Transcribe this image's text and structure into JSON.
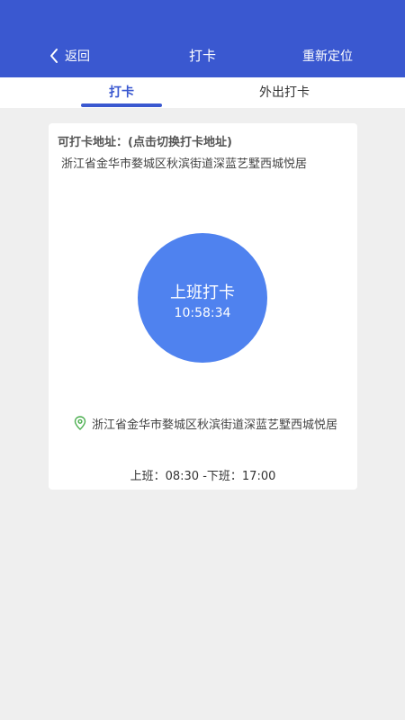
{
  "header": {
    "back_label": "返回",
    "title": "打卡",
    "relocate_label": "重新定位",
    "back_icon": "chevron-left-icon",
    "background": "#3a58d0"
  },
  "tabs": [
    {
      "label": "打卡",
      "active": true
    },
    {
      "label": "外出打卡",
      "active": false
    }
  ],
  "card": {
    "address_title": "可打卡地址：(点击切换打卡地址)",
    "address": "浙江省金华市婺城区秋滨街道深蓝艺墅西城悦居",
    "punch_button": {
      "label": "上班打卡",
      "time": "10:58:34",
      "color": "#4f82ef"
    },
    "location_icon": "map-pin-icon",
    "location_color": "#4caf50",
    "current_location": "浙江省金华市婺城区秋滨街道深蓝艺墅西城悦居",
    "hours": "上班：08:30 -下班：17:00"
  }
}
